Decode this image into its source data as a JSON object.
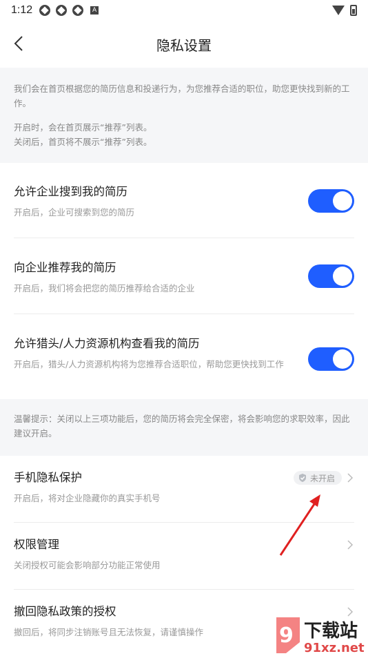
{
  "status_bar": {
    "time": "1:12",
    "notification_letter": "A"
  },
  "header": {
    "title": "隐私设置"
  },
  "intro": {
    "line1": "我们会在首页根据您的简历信息和投递行为，为您推荐合适的职位，助您更快找到新的工作。",
    "line2": "开启时，会在首页展示“推荐”列表。",
    "line3": "关闭后，首页将不展示“推荐”列表。"
  },
  "settings": [
    {
      "title": "允许企业搜到我的简历",
      "subtitle": "开启后，企业可搜索到您的简历",
      "enabled": true
    },
    {
      "title": "向企业推荐我的简历",
      "subtitle": "开启后，我们将会把您的简历推荐给合适的企业",
      "enabled": true
    },
    {
      "title": "允许猎头/人力资源机构查看我的简历",
      "subtitle": "开启后，猎头/人力资源机构将为您推荐合适职位，帮助您更快找到工作",
      "enabled": true
    }
  ],
  "tip": {
    "text": "温馨提示：关闭以上三项功能后，您的简历将会完全保密，将会影响您的求职效率，因此建议开启。"
  },
  "links": [
    {
      "title": "手机隐私保护",
      "subtitle": "开启后，将对企业隐藏你的真实手机号",
      "badge": "未开启"
    },
    {
      "title": "权限管理",
      "subtitle": "关闭授权可能会影响部分功能正常使用"
    },
    {
      "title": "撤回隐私政策的授权",
      "subtitle": "撤回后，将同步注销账号且无法恢复，请谨慎操作"
    }
  ],
  "watermark": {
    "main": "下载站",
    "domain": "91xz.net"
  },
  "colors": {
    "accent": "#1f5eff",
    "annotation_arrow": "#e02020",
    "section_bg": "#f5f6f8"
  }
}
